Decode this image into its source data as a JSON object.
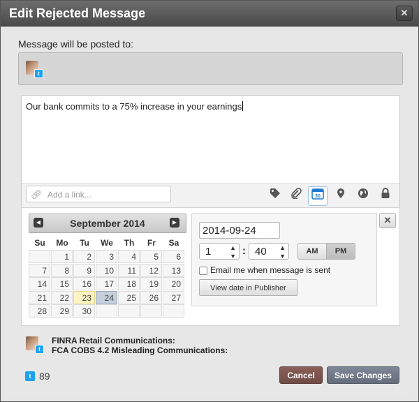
{
  "dialog": {
    "title": "Edit Rejected Message",
    "close_label": "✕"
  },
  "recipients": {
    "label": "Message will be posted to:"
  },
  "editor": {
    "message": "Our bank commits to a 75% increase in your earnings",
    "link_placeholder": "Add a link..."
  },
  "toolbar_icons": [
    "tag-icon",
    "paperclip-icon",
    "calendar-icon",
    "location-pin-icon",
    "globe-icon",
    "lock-icon"
  ],
  "calendar": {
    "month_label": "September 2014",
    "weekdays": [
      "Su",
      "Mo",
      "Tu",
      "We",
      "Th",
      "Fr",
      "Sa"
    ],
    "weeks": [
      [
        "",
        "1",
        "2",
        "3",
        "4",
        "5",
        "6"
      ],
      [
        "7",
        "8",
        "9",
        "10",
        "11",
        "12",
        "13"
      ],
      [
        "14",
        "15",
        "16",
        "17",
        "18",
        "19",
        "20"
      ],
      [
        "21",
        "22",
        "23",
        "24",
        "25",
        "26",
        "27"
      ],
      [
        "28",
        "29",
        "30",
        "",
        "",
        "",
        ""
      ]
    ],
    "today": "23",
    "selected": "24"
  },
  "schedule": {
    "date_value": "2014-09-24",
    "hour_value": "1",
    "colon": ":",
    "minute_value": "40",
    "am_label": "AM",
    "pm_label": "PM",
    "am_pm_selected": "PM",
    "email_label": "Email me when message is sent",
    "email_checked": false,
    "view_date_label": "View date in Publisher"
  },
  "compliance": {
    "lines": [
      "FINRA Retail Communications:",
      "FCA COBS 4.2 Misleading Communications:"
    ]
  },
  "footer": {
    "char_count": "89",
    "cancel_label": "Cancel",
    "save_label": "Save Changes"
  },
  "colors": {
    "twitter": "#1da1f2",
    "cancel_button": "#7d5650",
    "save_button": "#717889",
    "today": "#fdf4c4",
    "selected_day": "#c6cfdc"
  }
}
